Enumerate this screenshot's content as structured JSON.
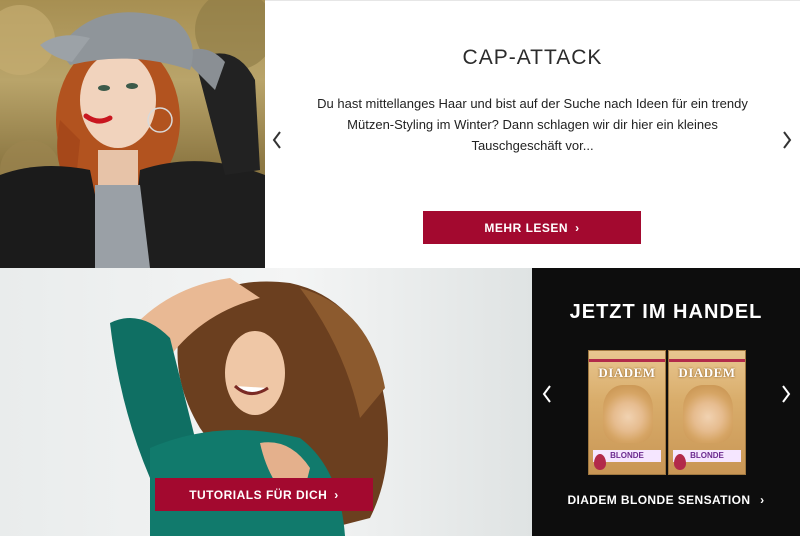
{
  "article": {
    "title": "CAP-ATTACK",
    "text": "Du hast mittellanges Haar und bist auf der Suche nach Ideen für ein trendy Mützen-Styling im Winter? Dann schlagen wir dir hier ein kleines Tauschgeschäft vor...",
    "button_label": "MEHR LESEN",
    "button_chevron": "›",
    "prev_icon": "chevron-left-icon",
    "next_icon": "chevron-right-icon"
  },
  "tutorials": {
    "button_label": "TUTORIALS FÜR DICH",
    "button_chevron": "›"
  },
  "shop": {
    "title": "JETZT IM HANDEL",
    "products": [
      {
        "brand": "DIADEM",
        "variant": "BLONDE"
      },
      {
        "brand": "DIADEM",
        "variant": "BLONDE"
      }
    ],
    "product_name": "DIADEM BLONDE SENSATION",
    "product_chevron": "›",
    "prev_icon": "chevron-left-icon",
    "next_icon": "chevron-right-icon"
  },
  "colors": {
    "accent": "#a3092f",
    "dark_panel": "#0d0d0d",
    "text": "#222222"
  }
}
